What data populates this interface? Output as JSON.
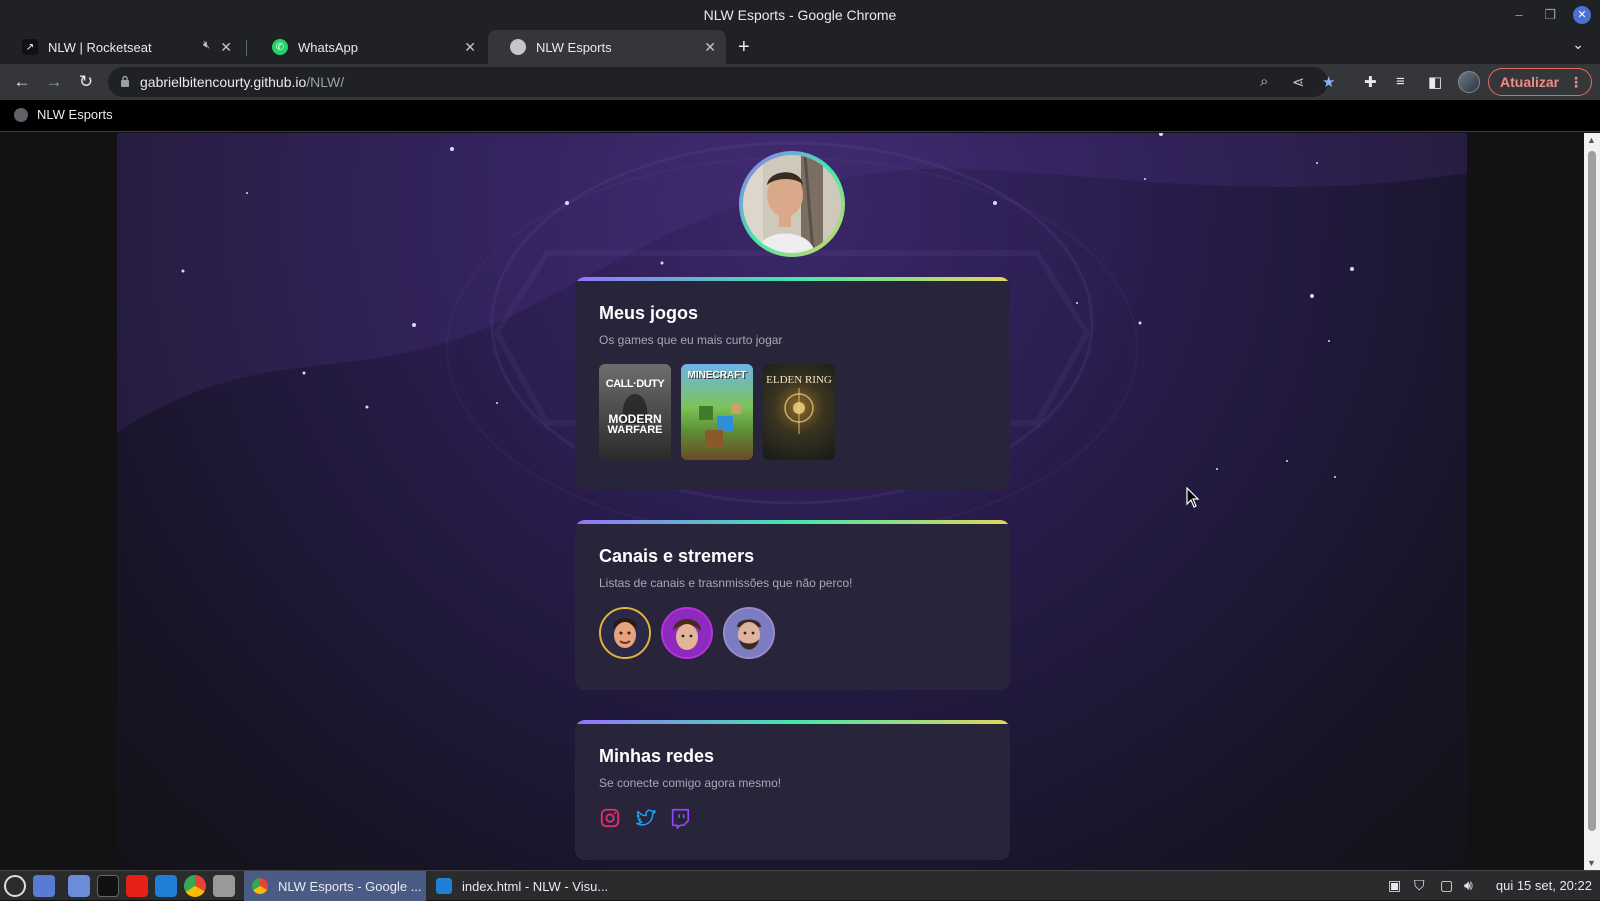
{
  "window": {
    "title": "NLW Esports - Google Chrome"
  },
  "tabs": [
    {
      "label": "NLW | Rocketseat",
      "muted": true
    },
    {
      "label": "WhatsApp"
    },
    {
      "label": "NLW Esports",
      "active": true
    }
  ],
  "address": {
    "host": "gabrielbitencourty.github.io",
    "path": "/NLW/"
  },
  "toolbar": {
    "update_label": "Atualizar"
  },
  "bookmarks": [
    {
      "label": "NLW Esports"
    }
  ],
  "page": {
    "games_card": {
      "title": "Meus jogos",
      "subtitle": "Os games que eu mais curto jogar",
      "games": [
        {
          "name": "Call of Duty Modern Warfare",
          "line1": "CALL·DUTY",
          "line2": "MODERN",
          "line3": "WARFARE"
        },
        {
          "name": "Minecraft",
          "line1": "MINECRAFT"
        },
        {
          "name": "Elden Ring",
          "line1": "ELDEN RING"
        }
      ]
    },
    "streamers_card": {
      "title": "Canais e stremers",
      "subtitle": "Listas de canais e trasnmissões que não perco!"
    },
    "socials_card": {
      "title": "Minhas redes",
      "subtitle": "Se conecte comigo agora mesmo!",
      "icons": [
        "instagram-icon",
        "twitter-icon",
        "twitch-icon"
      ]
    }
  },
  "colors": {
    "gradient_start": "#9572fc",
    "gradient_mid": "#43e7ad",
    "gradient_end": "#e2d45c",
    "card_bg": "#28243a",
    "instagram": "#e1306c",
    "twitter": "#1da1f2",
    "twitch": "#9146ff"
  },
  "taskbar": {
    "windows": [
      {
        "label": "NLW Esports - Google ...",
        "active": true
      },
      {
        "label": "index.html - NLW - Visu..."
      }
    ],
    "clock": "qui 15 set, 20:22"
  }
}
